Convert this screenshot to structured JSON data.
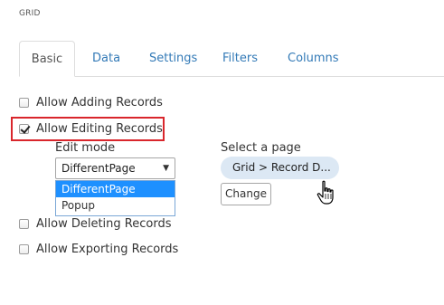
{
  "section_title": "GRID",
  "tabs": [
    {
      "label": "Basic",
      "active": true
    },
    {
      "label": "Data"
    },
    {
      "label": "Settings"
    },
    {
      "label": "Filters"
    },
    {
      "label": "Columns"
    }
  ],
  "options": {
    "allow_adding": {
      "label": "Allow Adding Records",
      "checked": false
    },
    "allow_editing": {
      "label": "Allow Editing Records",
      "checked": true
    },
    "allow_deleting": {
      "label": "Allow Deleting Records",
      "checked": false
    },
    "allow_exporting": {
      "label": "Allow Exporting Records",
      "checked": false
    }
  },
  "edit_mode": {
    "label": "Edit mode",
    "selected": "DifferentPage",
    "dropdown_options": [
      "DifferentPage",
      "Popup"
    ]
  },
  "page_select": {
    "label": "Select a page",
    "value": "Grid > Record D...",
    "change_button": "Change"
  },
  "colors": {
    "accent": "#337ab7",
    "highlight_border": "#d9262c",
    "selected_option": "#1e90ff",
    "pill_background": "#dce8f4"
  }
}
